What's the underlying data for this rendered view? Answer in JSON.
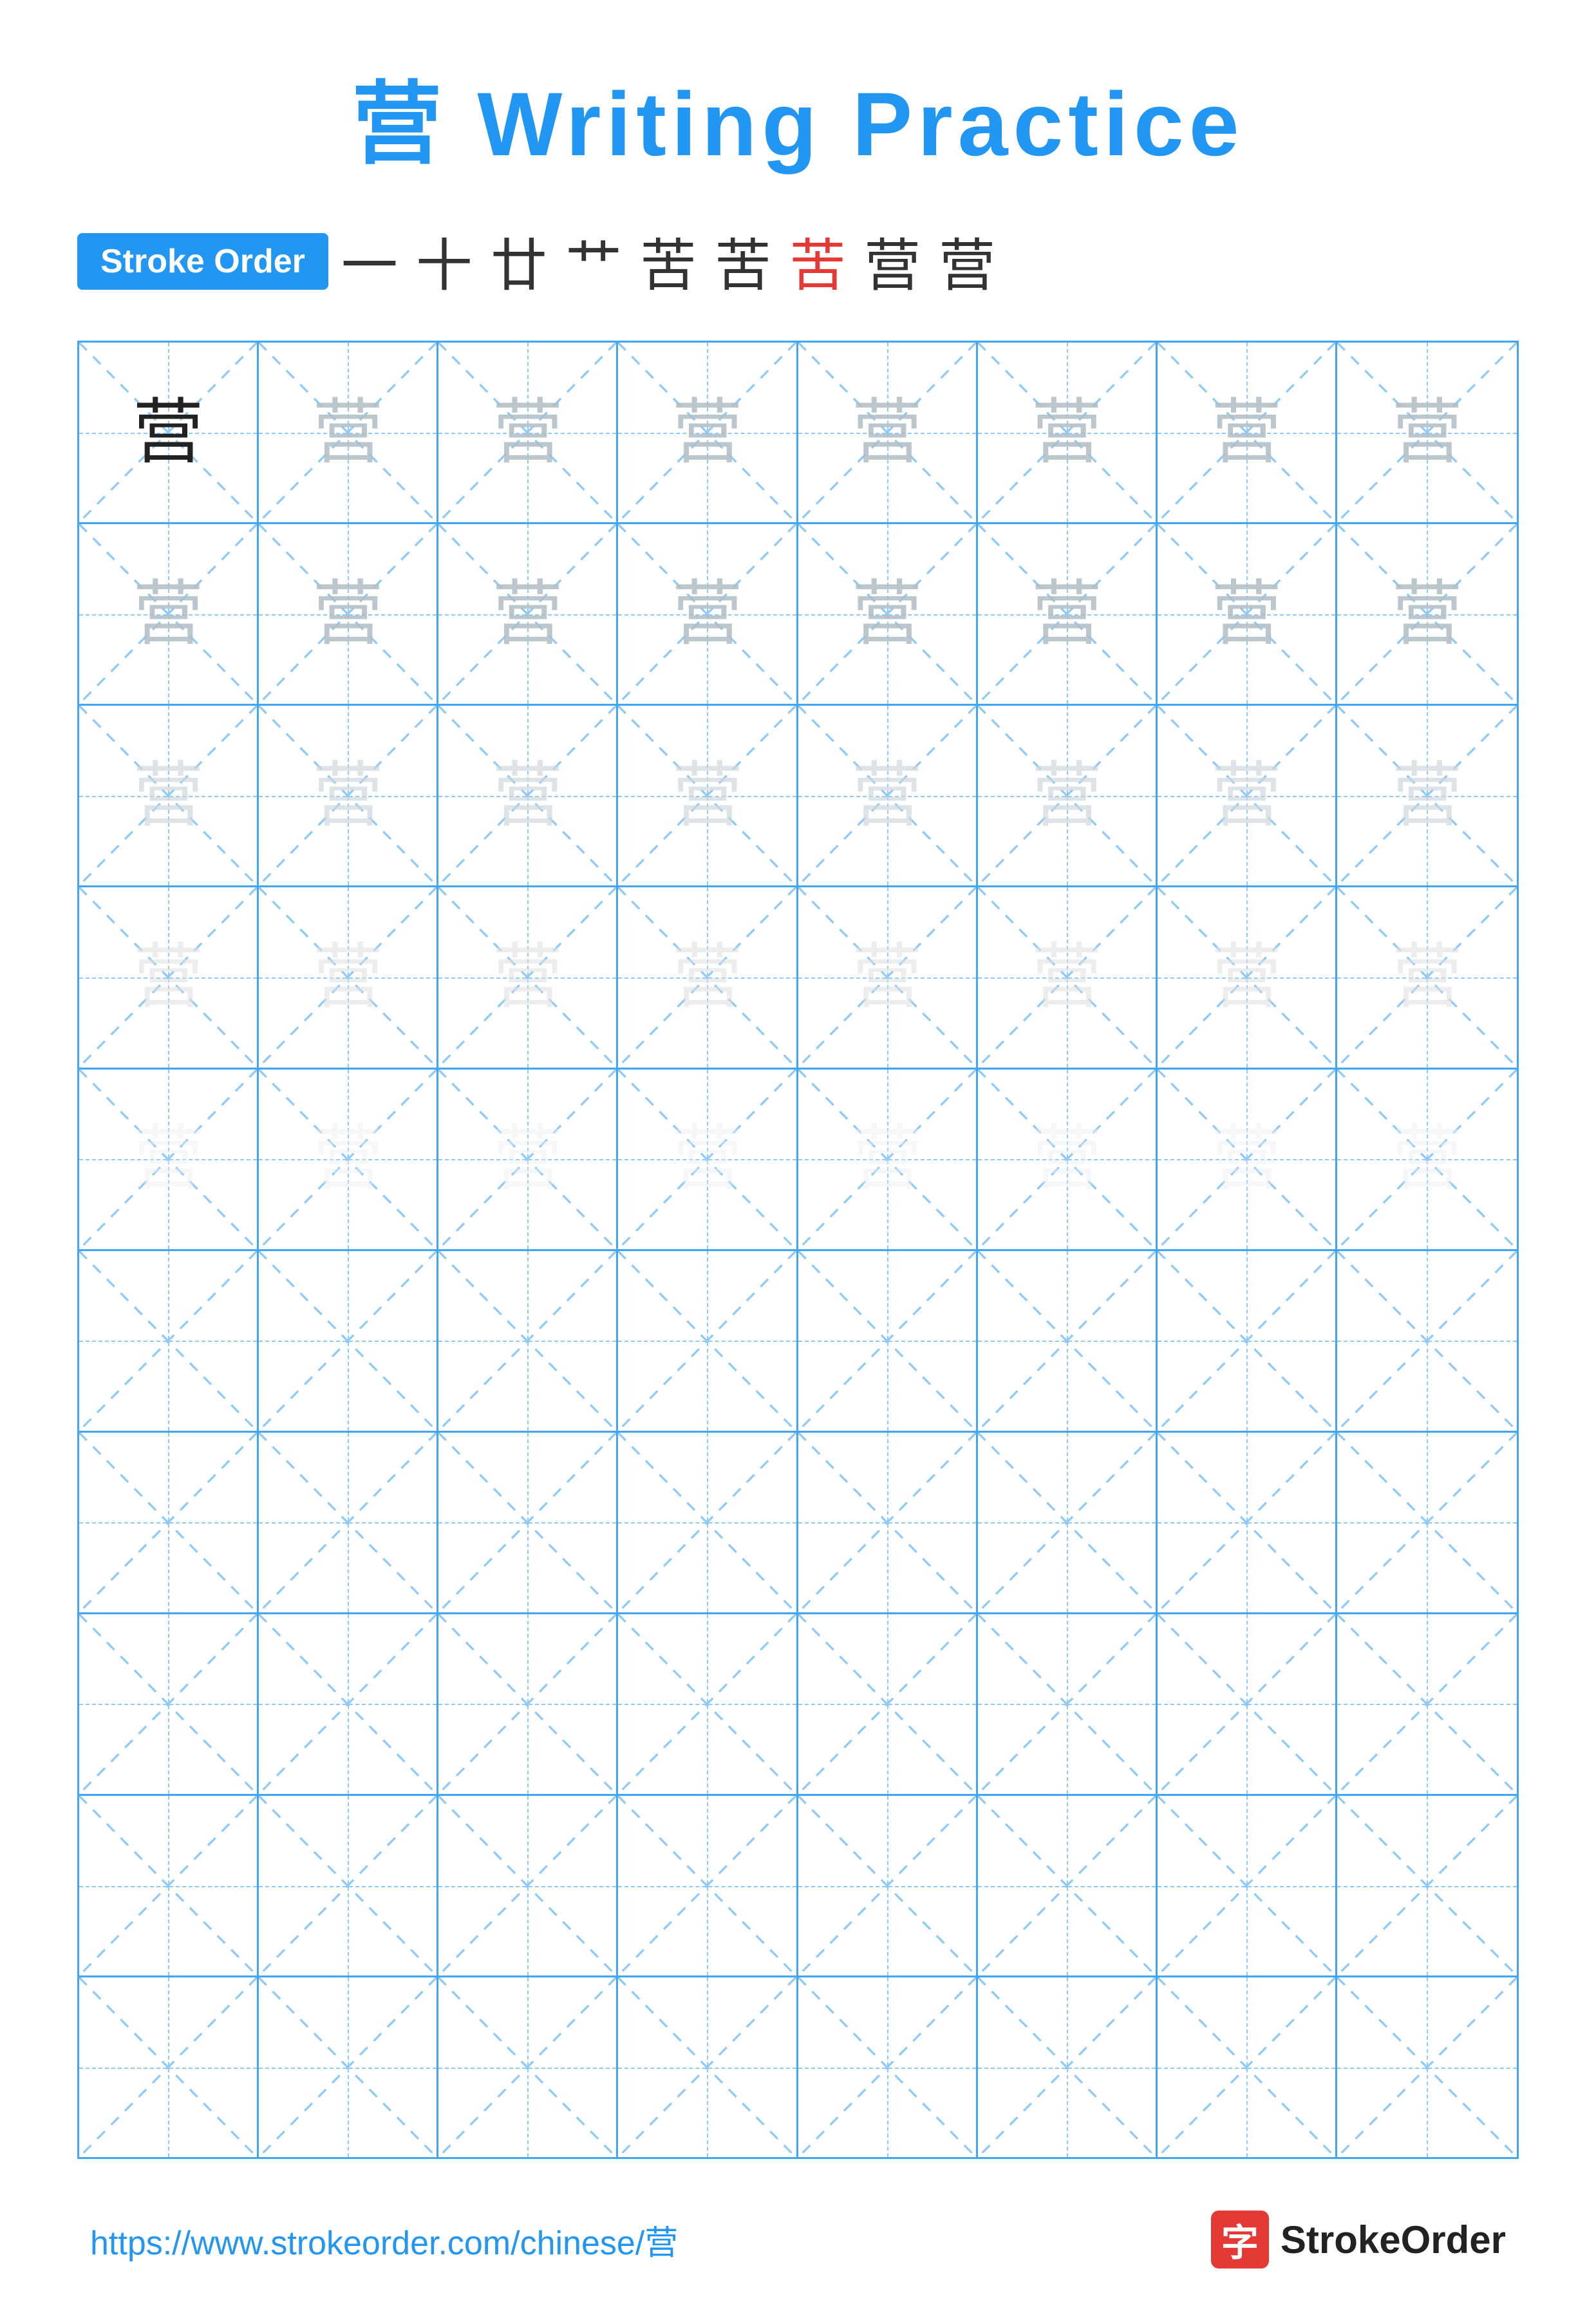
{
  "title": "营 Writing Practice",
  "stroke_order": {
    "badge_label": "Stroke Order",
    "chars": [
      "一",
      "十",
      "廿",
      "艹",
      "苦",
      "苦",
      "苦",
      "营",
      "营"
    ]
  },
  "main_char": "营",
  "grid": {
    "rows": 10,
    "cols": 8,
    "char_rows": [
      {
        "type": "dark",
        "count": 8
      },
      {
        "type": "light1",
        "count": 8
      },
      {
        "type": "light2",
        "count": 8
      },
      {
        "type": "light3",
        "count": 8
      },
      {
        "type": "light4",
        "count": 8
      },
      {
        "type": "empty",
        "count": 8
      },
      {
        "type": "empty",
        "count": 8
      },
      {
        "type": "empty",
        "count": 8
      },
      {
        "type": "empty",
        "count": 8
      },
      {
        "type": "empty",
        "count": 8
      }
    ]
  },
  "footer": {
    "url": "https://www.strokeorder.com/chinese/营",
    "logo_char": "字",
    "logo_text": "StrokeOrder"
  }
}
